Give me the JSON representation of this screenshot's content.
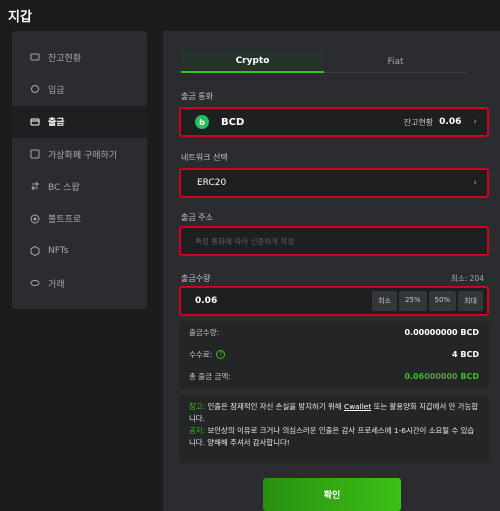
{
  "window": {
    "title": "지갑"
  },
  "sidebar": {
    "items": [
      {
        "label": "잔고현황",
        "icon": "balance-icon"
      },
      {
        "label": "입금",
        "icon": "deposit-icon"
      },
      {
        "label": "출금",
        "icon": "withdraw-icon",
        "active": true
      },
      {
        "label": "가상화폐 구매하기",
        "icon": "buy-crypto-icon"
      },
      {
        "label": "BC 스왑",
        "icon": "swap-icon"
      },
      {
        "label": "볼트프로",
        "icon": "vault-icon"
      },
      {
        "label": "NFTs",
        "icon": "nft-icon"
      },
      {
        "label": "거래",
        "icon": "transactions-icon"
      }
    ]
  },
  "tabs": [
    {
      "label": "Crypto",
      "active": true
    },
    {
      "label": "Fiat",
      "active": false
    }
  ],
  "currency": {
    "label": "출금 통화",
    "coin": "BCD",
    "balance_label": "잔고현황",
    "balance": "0.06"
  },
  "network": {
    "label": "네트워크 선택",
    "value": "ERC20"
  },
  "address": {
    "label": "출금 주소",
    "placeholder": "특정 통화에 따라 신중하게 작성"
  },
  "amount": {
    "label": "출금수량",
    "min_note": "최소: 204",
    "value": "0.06",
    "buttons": [
      "최소",
      "25%",
      "50%",
      "최대"
    ]
  },
  "summary": {
    "amount_label": "출금수량:",
    "amount_value_bold": "0.",
    "amount_value_dim": "00000000",
    "amount_unit": " BCD",
    "fee_label": "수수료:",
    "fee_value": "4 BCD",
    "total_label": "총 출금 금액:",
    "total_bold": "0.06",
    "total_dim": "000000",
    "total_unit": " BCD"
  },
  "notice": {
    "ref_label": "참고:",
    "ref_text_1": " 인출은 잠재적인 자신 손실을 방지하기 위해 ",
    "ref_link": "Cwallet",
    "ref_text_2": " 또는 활용양화 지갑에서 만 가능합니다.",
    "pub_label": "공지:",
    "pub_text": " 보안상의 이유로 크거나 의심스러운 인출은 감사 프로세스에 1-6시간이 소요될 수 있습니다. 양해해 주셔서 감사합니다!"
  },
  "confirm_label": "확인",
  "colors": {
    "accent": "#3bc117",
    "highlight_border": "#d0021b",
    "background": "#1b1c1e",
    "panel": "#2a2c2f"
  }
}
